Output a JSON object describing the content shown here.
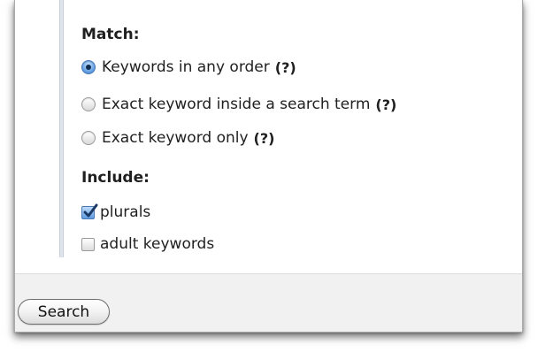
{
  "match": {
    "heading": "Match:",
    "options": [
      {
        "label": "Keywords in any order",
        "help": "(?)",
        "selected": true
      },
      {
        "label": "Exact keyword inside a search term",
        "help": "(?)",
        "selected": false
      },
      {
        "label": "Exact keyword only",
        "help": "(?)",
        "selected": false
      }
    ]
  },
  "include": {
    "heading": "Include:",
    "options": [
      {
        "label": "plurals",
        "checked": true
      },
      {
        "label": "adult keywords",
        "checked": false
      }
    ]
  },
  "footer": {
    "search_label": "Search"
  },
  "colors": {
    "accent": "#4a79b4",
    "footer_bg": "#f1f1f1",
    "rule": "#dfe3ea"
  }
}
